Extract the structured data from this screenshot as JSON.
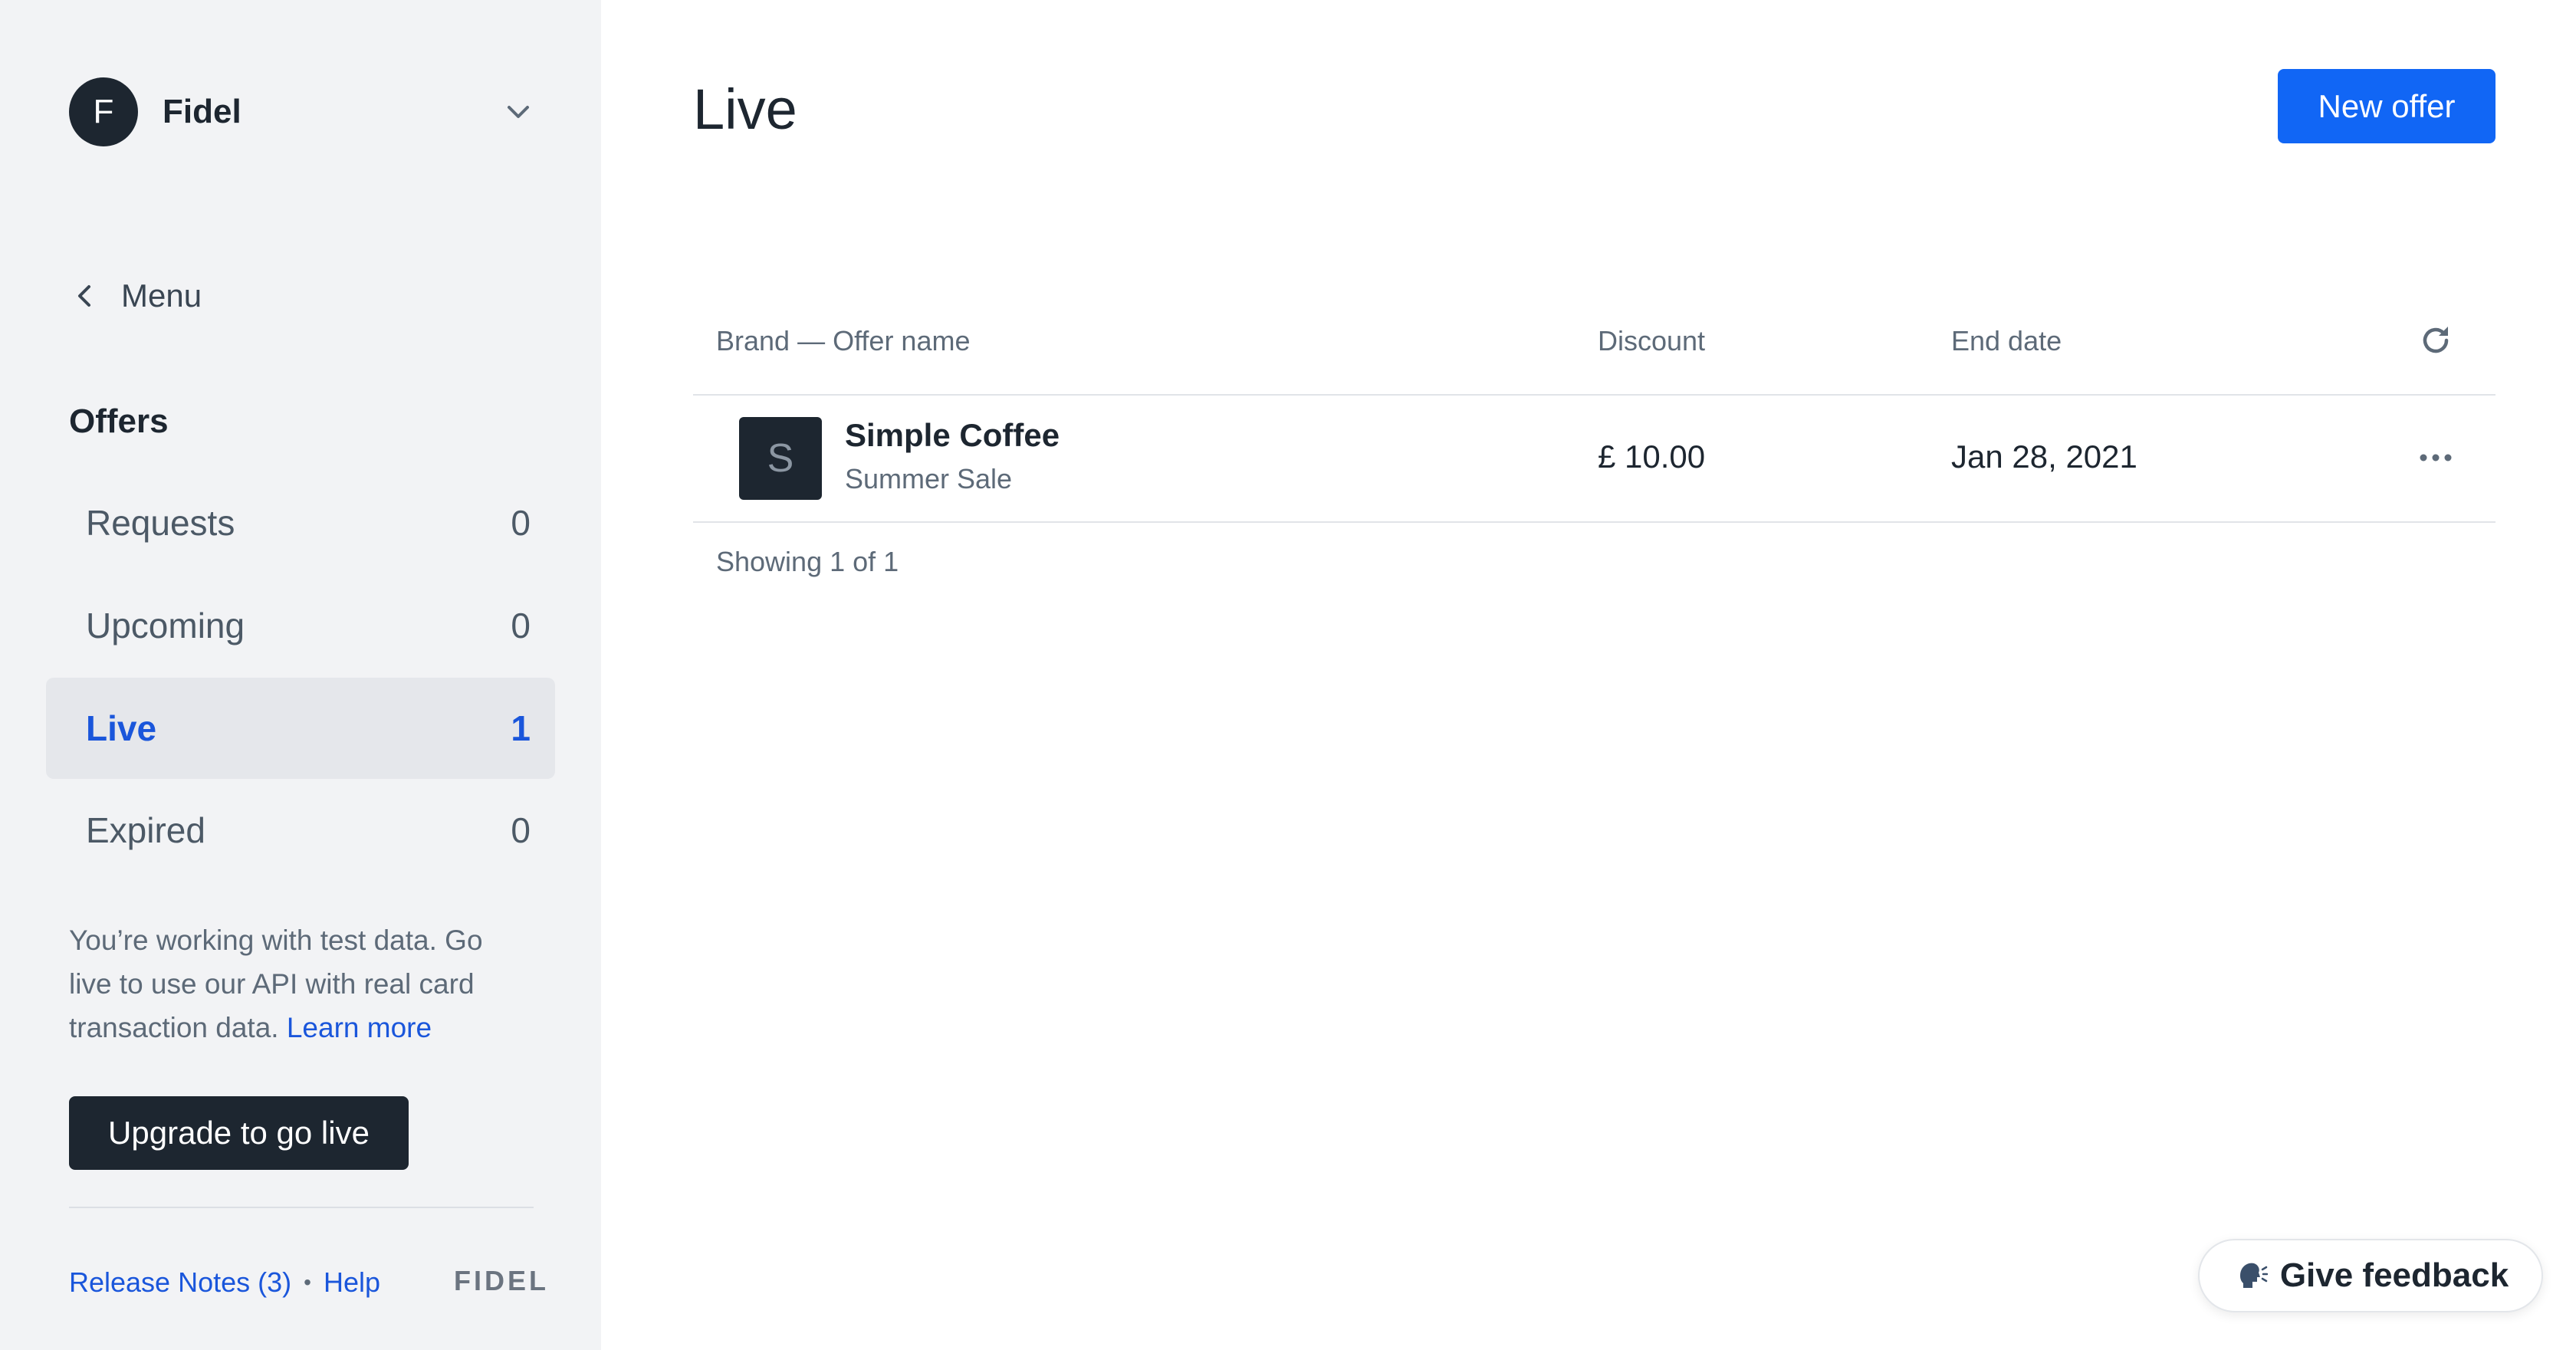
{
  "account": {
    "avatar_letter": "F",
    "name": "Fidel",
    "dropdown_icon": "chevron-down-icon"
  },
  "sidebar": {
    "back_label": "Menu",
    "back_icon": "chevron-left-icon",
    "section_title": "Offers",
    "items": [
      {
        "label": "Requests",
        "count": "0",
        "active": false
      },
      {
        "label": "Upcoming",
        "count": "0",
        "active": false
      },
      {
        "label": "Live",
        "count": "1",
        "active": true
      },
      {
        "label": "Expired",
        "count": "0",
        "active": false
      }
    ],
    "test_note": "You’re working with test data. Go live to use our API with real card transaction data.",
    "learn_more": "Learn more",
    "upgrade_label": "Upgrade to go live",
    "footer": {
      "release_notes": "Release Notes (3)",
      "separator": "•",
      "help": "Help",
      "brand": "FIDEL"
    }
  },
  "main": {
    "title": "Live",
    "new_offer_label": "New offer",
    "table": {
      "columns": [
        "Brand — Offer name",
        "Discount",
        "End date"
      ],
      "refresh_icon": "refresh-icon",
      "rows": [
        {
          "logo_letter": "S",
          "brand": "Simple Coffee",
          "offer": "Summer Sale",
          "discount": "£ 10.00",
          "end_date": "Jan 28, 2021",
          "menu_icon": "more-horizontal-icon"
        }
      ],
      "showing": "Showing 1 of 1"
    }
  },
  "feedback": {
    "label": "Give feedback",
    "icon": "speaking-head-icon"
  },
  "colors": {
    "accent": "#1166f5",
    "active_text": "#1a56db",
    "dark": "#1d2630",
    "sidebar_bg": "#f2f3f5"
  }
}
